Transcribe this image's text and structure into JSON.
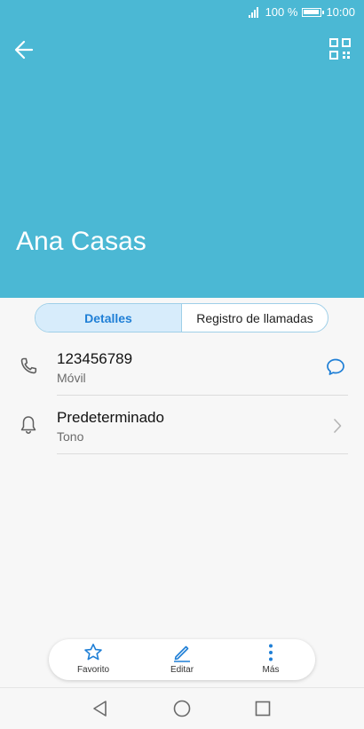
{
  "status_bar": {
    "signal_icon": "signal-icon",
    "battery_percent": "100 %",
    "battery_level": 1.0,
    "time": "10:00"
  },
  "header": {
    "back_icon": "back-arrow-icon",
    "qr_icon": "qr-code-icon",
    "contact_name": "Ana Casas",
    "color": "#4bb8d4"
  },
  "tabs": [
    {
      "label": "Detalles",
      "active": true
    },
    {
      "label": "Registro de llamadas",
      "active": false
    }
  ],
  "details": [
    {
      "icon": "phone-icon",
      "primary": "123456789",
      "secondary": "Móvil",
      "action_icon": "message-icon"
    },
    {
      "icon": "bell-icon",
      "primary": "Predeterminado",
      "secondary": "Tono",
      "action_icon": "chevron-right-icon"
    }
  ],
  "bottom_actions": [
    {
      "icon": "star-icon",
      "label": "Favorito"
    },
    {
      "icon": "edit-icon",
      "label": "Editar"
    },
    {
      "icon": "more-vertical-icon",
      "label": "Más"
    }
  ],
  "navigation": [
    {
      "icon": "nav-back-icon"
    },
    {
      "icon": "nav-home-icon"
    },
    {
      "icon": "nav-recents-icon"
    }
  ],
  "colors": {
    "accent": "#1f7fd6",
    "header": "#4bb8d4"
  }
}
